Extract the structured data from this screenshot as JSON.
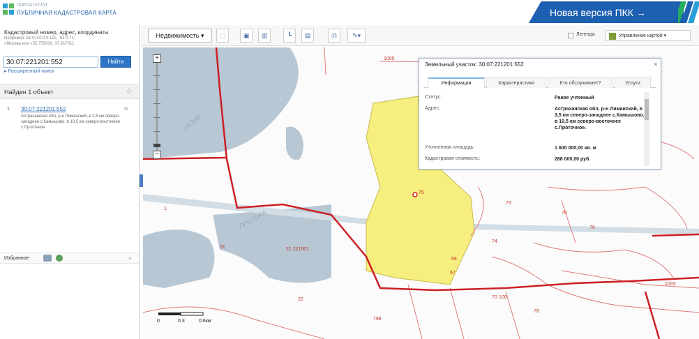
{
  "header": {
    "portal_small": "ПОРТАЛ УСЛУГ",
    "portal_title": "ПУБЛИЧНАЯ КАДАСТРОВАЯ КАРТА",
    "new_version": "Новая версия ПКК →",
    "accent": "#1d5fb1"
  },
  "search": {
    "title": "Кадастровый номер, адрес, координаты",
    "example_line1": "Например: 61:0:0:0:0:0:12s, :61:0:71:",
    "example_line2": "«Москва или «55.755000, 37.617011",
    "value": "30:07:221201:552",
    "find_label": "Найти",
    "advanced_label": "▸ Расширенный поиск"
  },
  "results": {
    "found_label": "Найден 1 объект",
    "star_icon": "star-icon",
    "items": [
      {
        "num": "1",
        "number": "30:07:221201:552",
        "address": "Астраханская обл, р-н Лиманский, в 3,5 км северо-западнее с.Камышово, в 10,5 км северо-восточнее с.Проточное"
      }
    ]
  },
  "favorites": {
    "label": "Избранное"
  },
  "toolbar": {
    "layer_select": "Недвижимость ▾",
    "legend_label": "Легенда",
    "map_control_label": "Управление картой ▾"
  },
  "popup": {
    "title": "Земельный участок: 30:07:221201:552",
    "close_icon": "close-icon",
    "tabs": [
      "Информация",
      "Характеристики",
      "Кто обслуживает?",
      "Услуги"
    ],
    "active_tab": "Информация",
    "fields": [
      {
        "label": "Статус:",
        "value": "Ранее учтенный"
      },
      {
        "label": "Адрес:",
        "value": "Астраханская обл, р-н Лиманский, в 3,5 км северо-западнее с.Камышово, в 10,5 км северо-восточнее с.Проточное."
      },
      {
        "label": "Уточненная площадь:",
        "value": "1 600 000,00 кв. м"
      },
      {
        "label": "Кадастровая стоимость:",
        "value": "288 000,00 руб."
      }
    ]
  },
  "map": {
    "labels": [
      "1005",
      "75",
      "73",
      "21 221501",
      "67",
      "74",
      "76",
      "1003",
      "22",
      "798",
      "78",
      "68",
      "70",
      "51",
      "70",
      "1",
      "100"
    ],
    "scale_labels": [
      "0",
      "0.3",
      "0.6км"
    ],
    "colors": {
      "water": "#b7c7d4",
      "parcel": "#f6ef7f",
      "boundary": "#cc1f24",
      "contour": "#e07a7a"
    }
  }
}
